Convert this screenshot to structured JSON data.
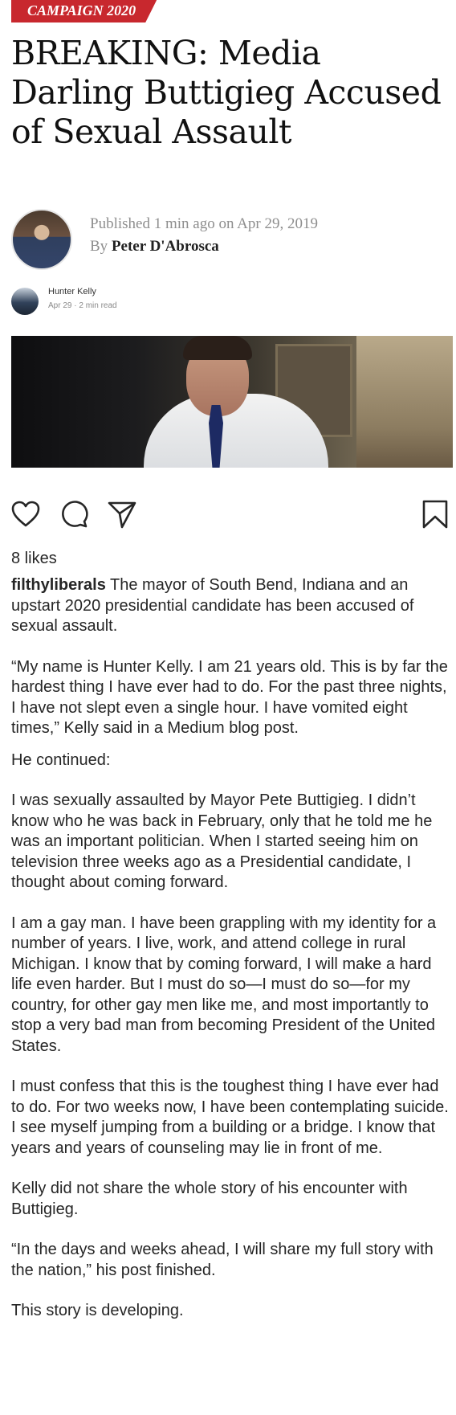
{
  "article": {
    "section_tag": "CAMPAIGN 2020",
    "headline": "BREAKING: Media Darling Buttigieg Accused of Sexual Assault",
    "published": "Published 1 min ago on Apr 29, 2019",
    "by_prefix": "By",
    "author": "Peter D'Abrosca"
  },
  "medium_post": {
    "author": "Hunter Kelly",
    "date_read": "Apr 29 · 2 min read"
  },
  "instagram": {
    "likes": "8 likes",
    "username": "filthyliberals",
    "icons": [
      "heart-icon",
      "comment-icon",
      "share-icon",
      "bookmark-icon"
    ],
    "caption": [
      "The mayor of South Bend, Indiana and an upstart 2020 presidential candidate has been accused of sexual assault.",
      "“My name is Hunter Kelly. I am 21 years old. This is by far the hardest thing I have ever had to do. For the past three nights, I have not slept even a single hour. I have vomited eight times,” Kelly said in a Medium blog post.",
      "He continued:",
      "I was sexually assaulted by Mayor Pete Buttigieg. I didn’t know who he was back in February, only that he told me he was an important politician. When I started seeing him on television three weeks ago as a Presidential candidate, I thought about coming forward.",
      "I am a gay man. I have been grappling with my identity for a number of years. I live, work, and attend college in rural Michigan. I know that by coming forward, I will make a hard life even harder. But I must do so—I must do so—for my country, for other gay men like me, and most importantly to stop a very bad man from becoming President of the United States.",
      "I must confess that this is the toughest thing I have ever had to do. For two weeks now, I have been contemplating suicide. I see myself jumping from a building or a bridge. I know that years and years of counseling may lie in front of me.",
      "Kelly did not share the whole story of his encounter with Buttigieg.",
      "“In the days and weeks ahead, I will share my full story with the nation,” his post finished.",
      "This story is developing."
    ]
  },
  "colors": {
    "tag_red": "#c8282e",
    "text": "#262626",
    "meta_gray": "#8e8e8e"
  }
}
